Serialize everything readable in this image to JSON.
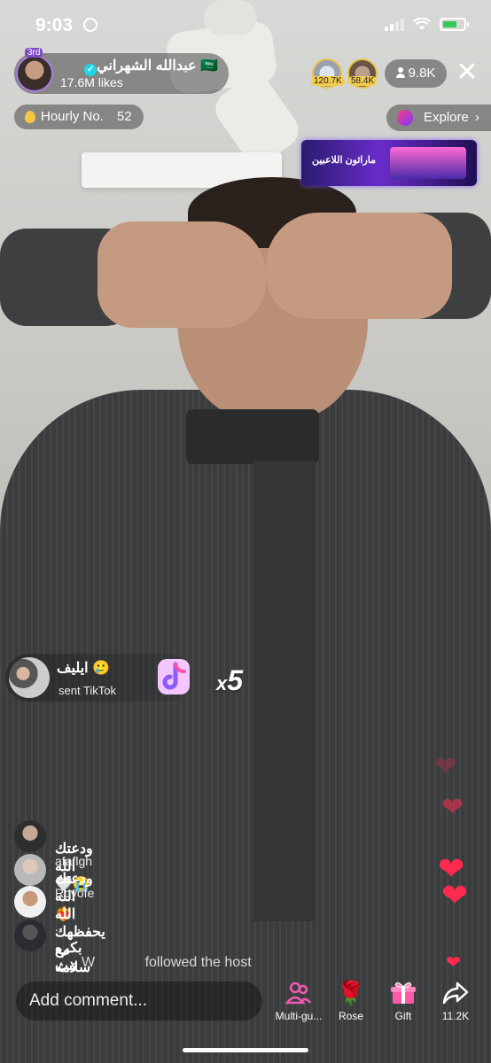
{
  "status_bar": {
    "time": "9:03",
    "battery_level": 0.7
  },
  "host": {
    "name": "عبدالله الشهراني",
    "flag": "🇸🇦",
    "likes": "17.6M likes",
    "rank_badge": "3rd"
  },
  "top_viewers": [
    {
      "count": "120.7K"
    },
    {
      "count": "58.4K"
    }
  ],
  "viewer_count": "9.8K",
  "hourly": {
    "label": "Hourly No.",
    "value": "52"
  },
  "explore": {
    "label": "Explore",
    "chevron": "›"
  },
  "banner": {
    "text": "ماراثون اللاعبين"
  },
  "gift": {
    "user": "ايليف 🥲",
    "subtitle": "sent TikTok",
    "combo_prefix": "x",
    "combo_count": "5"
  },
  "comments": [
    {
      "user": "",
      "text": "ودعتك الله🤍😭"
    },
    {
      "user": "afaflgh",
      "text": "ودعتك الله❤️‍🔥"
    },
    {
      "user": "Royofe",
      "text": "الله يحفظهك مع سلامه"
    },
    {
      "user": ".",
      "text": "بكره تبث"
    }
  ],
  "follow_event": {
    "user": "W",
    "text": "followed the host"
  },
  "comment_input": {
    "placeholder": "Add comment..."
  },
  "bottom_actions": [
    {
      "label": "Multi-gu...",
      "icon": "multi-guest-icon"
    },
    {
      "label": "Rose",
      "icon": "rose-icon"
    },
    {
      "label": "Gift",
      "icon": "gift-icon"
    },
    {
      "label": "11.2K",
      "icon": "share-icon"
    }
  ],
  "colors": {
    "accent": "#20d5ec",
    "heart": "#ff2b4e",
    "gold": "#f2cc4e"
  }
}
